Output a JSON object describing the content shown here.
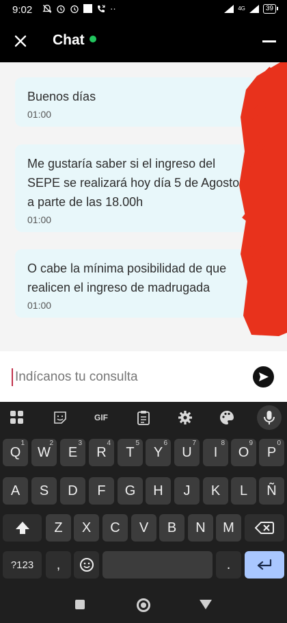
{
  "status_bar": {
    "time": "9:02",
    "more": "··",
    "network": "4G",
    "battery": "39"
  },
  "header": {
    "title": "Chat",
    "status_color": "#22c55e"
  },
  "messages": [
    {
      "text": "Buenos días",
      "time": "01:00"
    },
    {
      "text": "Me gustaría saber si el ingreso del SEPE se realizará hoy día 5 de Agosto, a parte de las 18.00h",
      "time": "01:00"
    },
    {
      "text": "O cabe la mínima posibilidad de que realicen el ingreso de madrugada",
      "time": "01:00"
    }
  ],
  "input": {
    "placeholder": "Indícanos tu consulta"
  },
  "keyboard": {
    "toolbar": {
      "gif": "GIF"
    },
    "row1": [
      {
        "k": "Q",
        "s": "1"
      },
      {
        "k": "W",
        "s": "2"
      },
      {
        "k": "E",
        "s": "3"
      },
      {
        "k": "R",
        "s": "4"
      },
      {
        "k": "T",
        "s": "5"
      },
      {
        "k": "Y",
        "s": "6"
      },
      {
        "k": "U",
        "s": "7"
      },
      {
        "k": "I",
        "s": "8"
      },
      {
        "k": "O",
        "s": "9"
      },
      {
        "k": "P",
        "s": "0"
      }
    ],
    "row2": [
      "A",
      "S",
      "D",
      "F",
      "G",
      "H",
      "J",
      "K",
      "L",
      "Ñ"
    ],
    "row3": [
      "Z",
      "X",
      "C",
      "V",
      "B",
      "N",
      "M"
    ],
    "symbols_key": "?123",
    "comma_key": ",",
    "period_key": "."
  }
}
